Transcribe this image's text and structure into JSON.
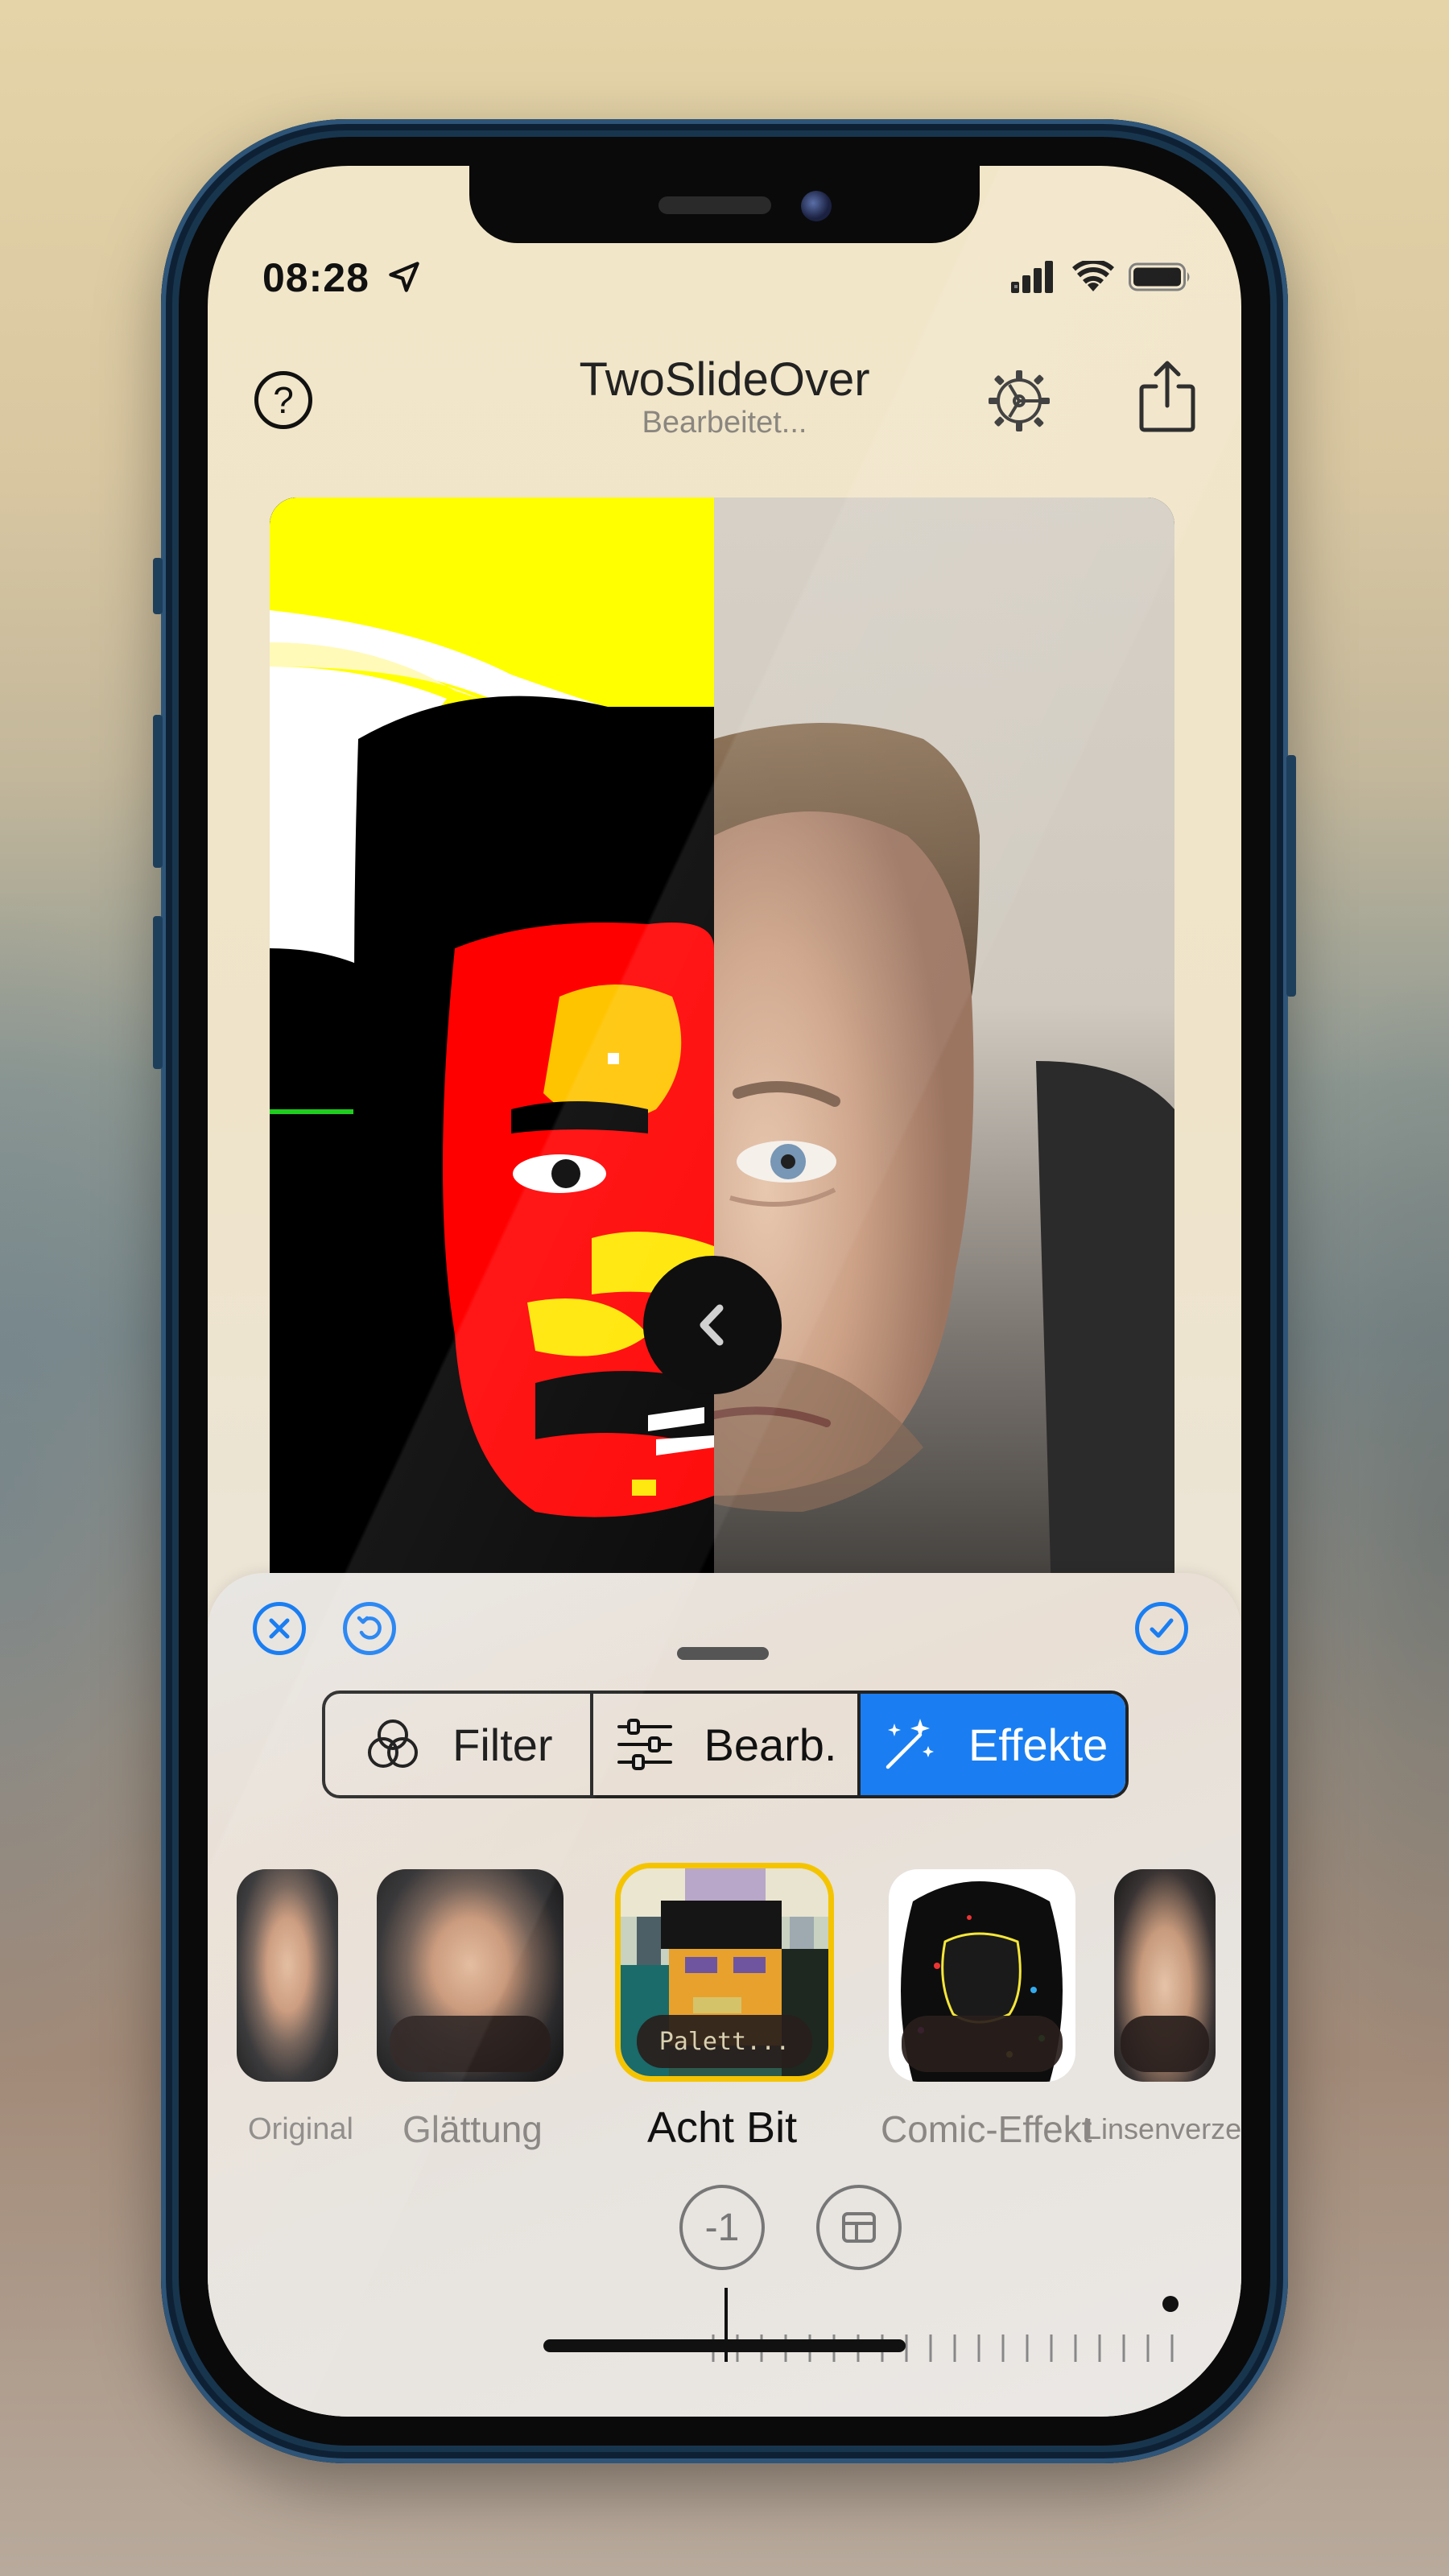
{
  "status_bar": {
    "time": "08:28",
    "icons": [
      "location-arrow-icon",
      "cellular-signal-icon",
      "wifi-icon",
      "battery-icon"
    ]
  },
  "nav": {
    "title": "TwoSlideOver",
    "subtitle": "Bearbeitet...",
    "help_label": "?",
    "icons": [
      "help-icon",
      "settings-gear-icon",
      "share-icon"
    ]
  },
  "photo": {
    "left_style": "8-bit pixel effect (yellow, red, black, white palette)",
    "right_style": "original photo",
    "divider_icon": "chevron-left-icon"
  },
  "sheet": {
    "tabs": [
      {
        "label": "Filter",
        "icon": "filter-circles-icon",
        "active": false
      },
      {
        "label": "Bearb.",
        "icon": "sliders-icon",
        "active": false
      },
      {
        "label": "Effekte",
        "icon": "magic-wand-icon",
        "active": true
      }
    ],
    "effects": [
      {
        "label": "Original",
        "selected": false
      },
      {
        "label": "Glättung",
        "selected": false
      },
      {
        "label": "Acht Bit",
        "selected": true,
        "overlay": "Palett..."
      },
      {
        "label": "Comic-Effekt",
        "selected": false
      },
      {
        "label": "Linsenverzerrung",
        "selected": false
      }
    ],
    "value_label": "-1",
    "slider_position": 0.0,
    "accent_color": "#1a7ef2",
    "selection_color": "#f5c400"
  }
}
